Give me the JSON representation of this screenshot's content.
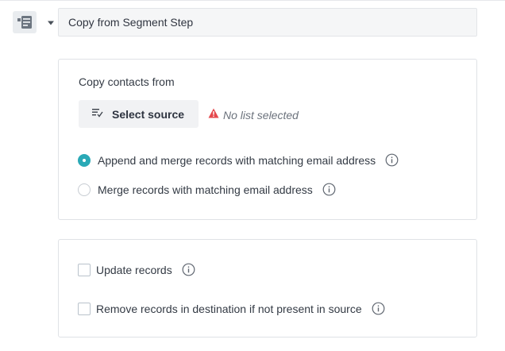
{
  "step": {
    "icon": "segment-step-icon",
    "caret_icon": "caret-down-icon",
    "title": "Copy from Segment Step"
  },
  "source_card": {
    "label": "Copy contacts from",
    "select_button": {
      "icon": "list-select-icon",
      "label": "Select source"
    },
    "warning": {
      "icon": "warning-triangle-icon",
      "text": "No list selected",
      "color": "#e5484d"
    },
    "merge_options": [
      {
        "label": "Append and merge records with matching email address",
        "selected": true
      },
      {
        "label": "Merge records with matching email address",
        "selected": false
      }
    ]
  },
  "options_card": {
    "checkboxes": [
      {
        "label": "Update records",
        "checked": false
      },
      {
        "label": "Remove records in destination if not present in source",
        "checked": false
      }
    ]
  },
  "colors": {
    "accent": "#2aa9b6",
    "warning": "#e5484d"
  }
}
